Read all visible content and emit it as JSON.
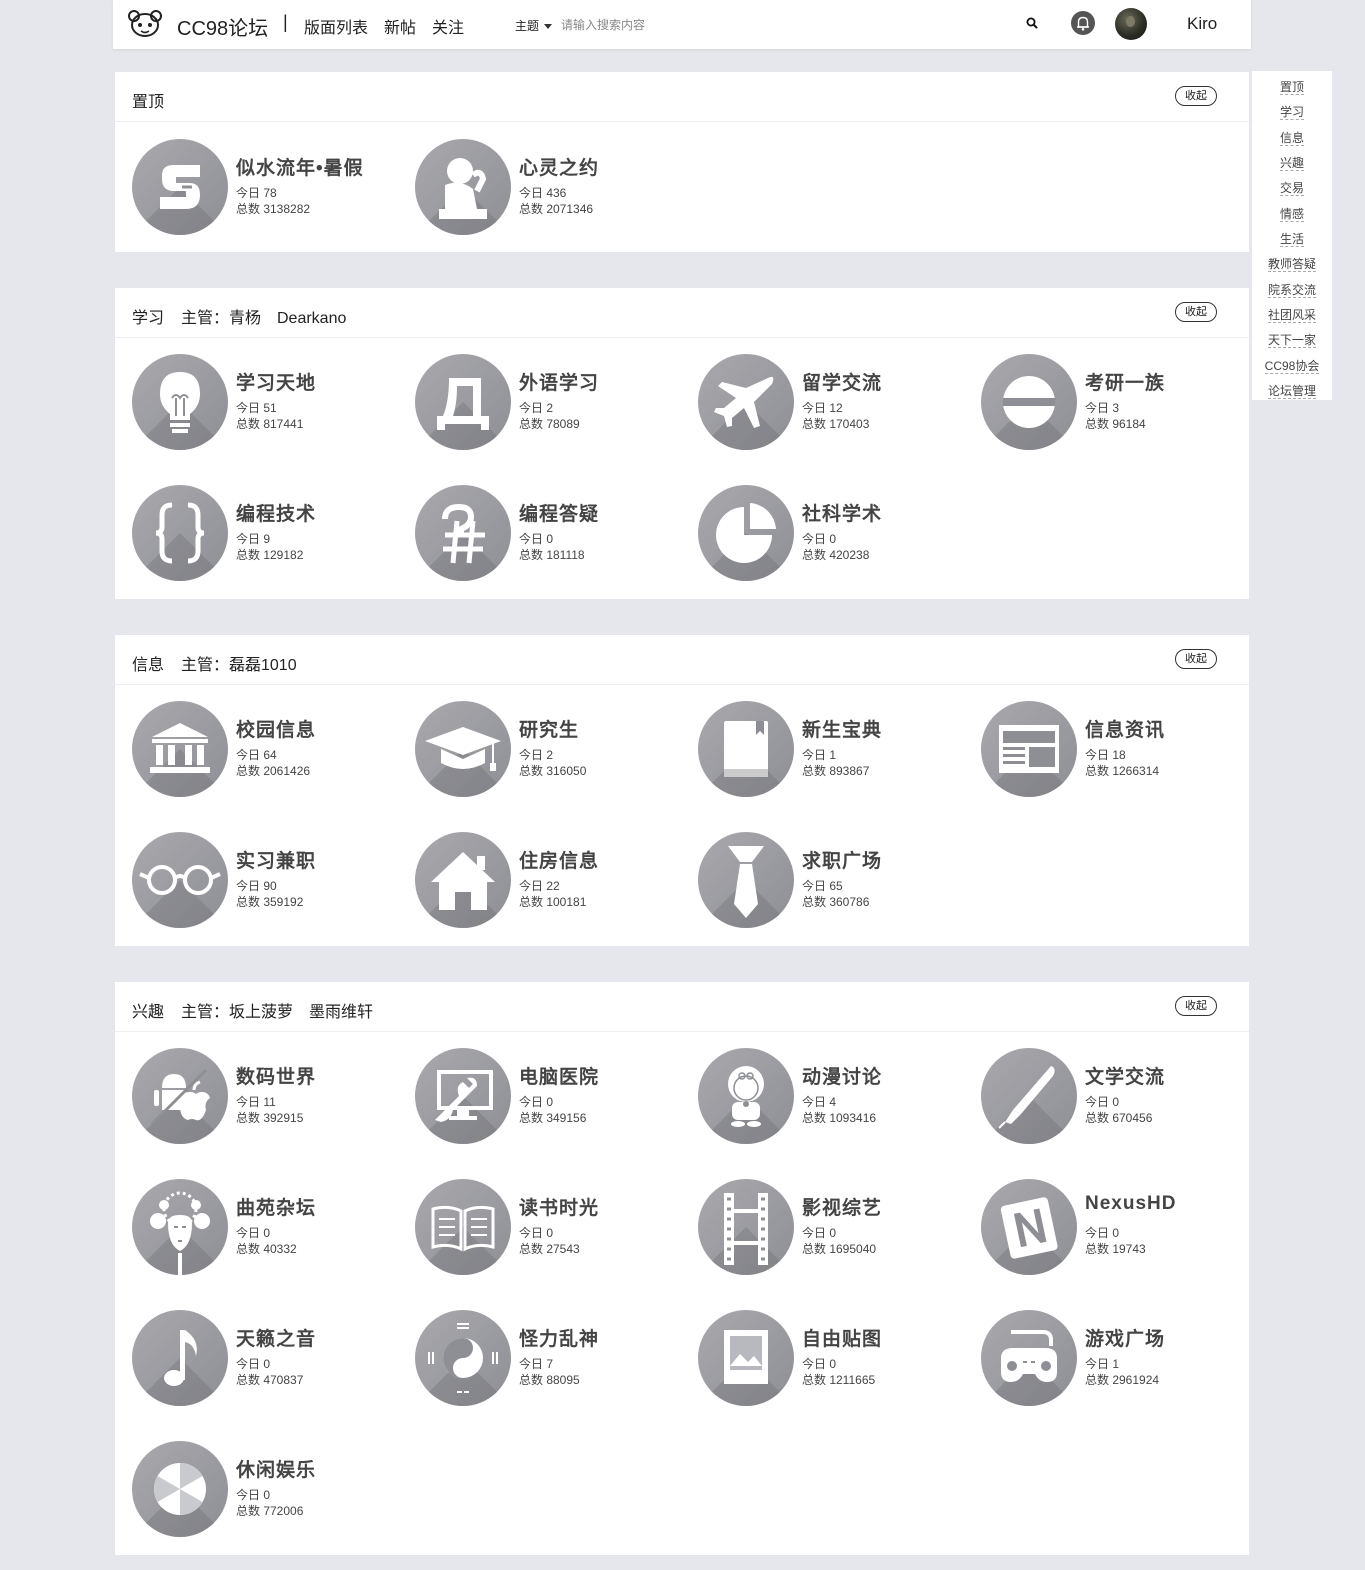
{
  "header": {
    "brand": "CC98论坛",
    "separator": "|",
    "nav": [
      "版面列表",
      "新帖",
      "关注"
    ],
    "search_type": "主题",
    "search_placeholder": "请输入搜索内容",
    "username": "Kiro"
  },
  "side_index": [
    "置顶",
    "学习",
    "信息",
    "兴趣",
    "交易",
    "情感",
    "生活",
    "教师答疑",
    "院系交流",
    "社团风采",
    "天下一家",
    "CC98协会",
    "论坛管理"
  ],
  "sections": [
    {
      "title": "置顶",
      "managers": "",
      "collapse_label": "收起",
      "boards": [
        {
          "name": "似水流年•暑假",
          "today": "今日 78",
          "total": "总数 3138282",
          "icon": "logo-s-icon"
        },
        {
          "name": "心灵之约",
          "today": "今日 436",
          "total": "总数 2071346",
          "icon": "thinker-icon"
        }
      ]
    },
    {
      "title": "学习",
      "managers": "主管：青杨　Dearkano",
      "collapse_label": "收起",
      "boards": [
        {
          "name": "学习天地",
          "today": "今日 51",
          "total": "总数 817441",
          "icon": "lightbulb-icon"
        },
        {
          "name": "外语学习",
          "today": "今日 2",
          "total": "总数 78089",
          "icon": "cyrillic-d-icon"
        },
        {
          "name": "留学交流",
          "today": "今日 12",
          "total": "总数 170403",
          "icon": "airplane-icon"
        },
        {
          "name": "考研一族",
          "today": "今日 3",
          "total": "总数 96184",
          "icon": "theta-icon"
        },
        {
          "name": "编程技术",
          "today": "今日 9",
          "total": "总数 129182",
          "icon": "braces-icon"
        },
        {
          "name": "编程答疑",
          "today": "今日 0",
          "total": "总数 181118",
          "icon": "question-hash-icon"
        },
        {
          "name": "社科学术",
          "today": "今日 0",
          "total": "总数 420238",
          "icon": "pie-chart-icon"
        }
      ]
    },
    {
      "title": "信息",
      "managers": "主管：磊磊1010",
      "collapse_label": "收起",
      "boards": [
        {
          "name": "校园信息",
          "today": "今日 64",
          "total": "总数 2061426",
          "icon": "building-icon"
        },
        {
          "name": "研究生",
          "today": "今日 2",
          "total": "总数 316050",
          "icon": "graduation-cap-icon"
        },
        {
          "name": "新生宝典",
          "today": "今日 1",
          "total": "总数 893867",
          "icon": "book-icon"
        },
        {
          "name": "信息资讯",
          "today": "今日 18",
          "total": "总数 1266314",
          "icon": "newspaper-icon"
        },
        {
          "name": "实习兼职",
          "today": "今日 90",
          "total": "总数 359192",
          "icon": "glasses-icon"
        },
        {
          "name": "住房信息",
          "today": "今日 22",
          "total": "总数 100181",
          "icon": "house-icon"
        },
        {
          "name": "求职广场",
          "today": "今日 65",
          "total": "总数 360786",
          "icon": "tie-icon"
        }
      ]
    },
    {
      "title": "兴趣",
      "managers": "主管：坂上菠萝　墨雨维轩",
      "collapse_label": "收起",
      "boards": [
        {
          "name": "数码世界",
          "today": "今日 11",
          "total": "总数 392915",
          "icon": "android-apple-icon"
        },
        {
          "name": "电脑医院",
          "today": "今日 0",
          "total": "总数 349156",
          "icon": "monitor-wrench-icon"
        },
        {
          "name": "动漫讨论",
          "today": "今日 4",
          "total": "总数 1093416",
          "icon": "doraemon-icon"
        },
        {
          "name": "文学交流",
          "today": "今日 0",
          "total": "总数 670456",
          "icon": "pen-icon"
        },
        {
          "name": "曲苑杂坛",
          "today": "今日 0",
          "total": "总数 40332",
          "icon": "opera-mask-icon"
        },
        {
          "name": "读书时光",
          "today": "今日 0",
          "total": "总数 27543",
          "icon": "open-book-icon"
        },
        {
          "name": "影视综艺",
          "today": "今日 0",
          "total": "总数 1695040",
          "icon": "film-icon"
        },
        {
          "name": "NexusHD",
          "today": "今日 0",
          "total": "总数 19743",
          "icon": "n-logo-icon"
        },
        {
          "name": "天籁之音",
          "today": "今日 0",
          "total": "总数 470837",
          "icon": "music-note-icon"
        },
        {
          "name": "怪力乱神",
          "today": "今日 7",
          "total": "总数 88095",
          "icon": "yin-yang-icon"
        },
        {
          "name": "自由贴图",
          "today": "今日 0",
          "total": "总数 1211665",
          "icon": "picture-icon"
        },
        {
          "name": "游戏广场",
          "today": "今日 1",
          "total": "总数 2961924",
          "icon": "gamepad-icon"
        },
        {
          "name": "休闲娱乐",
          "today": "今日 0",
          "total": "总数 772006",
          "icon": "umbrella-icon"
        }
      ]
    }
  ]
}
